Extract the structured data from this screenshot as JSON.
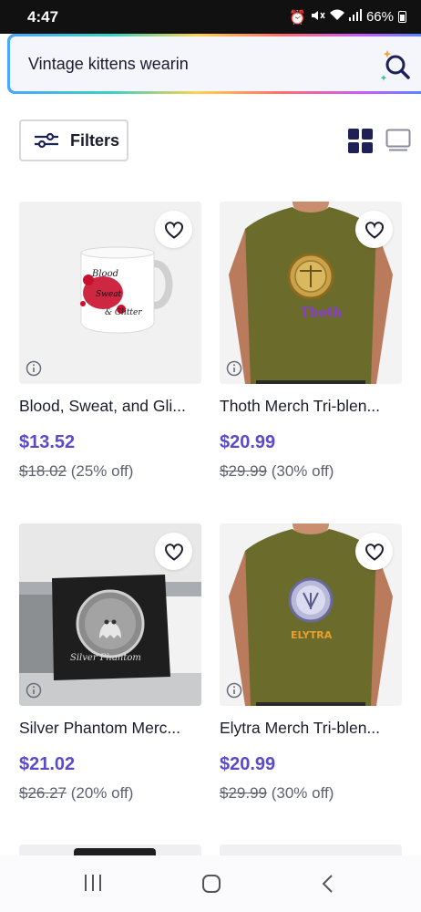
{
  "status_bar": {
    "time": "4:47",
    "battery": "66%"
  },
  "search": {
    "value": "Vintage kittens wearin"
  },
  "toolbar": {
    "filters_label": "Filters"
  },
  "products": [
    {
      "title": "Blood, Sweat, and Gli...",
      "price": "$13.52",
      "original_price": "$18.02",
      "discount": "(25% off)",
      "image_text": [
        "Blood",
        "Sweat",
        "& Glitter"
      ]
    },
    {
      "title": "Thoth Merch Tri-blen...",
      "price": "$20.99",
      "original_price": "$29.99",
      "discount": "(30% off)",
      "image_text": [
        "Thoth"
      ]
    },
    {
      "title": "Silver Phantom Merc...",
      "price": "$21.02",
      "original_price": "$26.27",
      "discount": "(20% off)",
      "image_text": [
        "Silver Phantom"
      ]
    },
    {
      "title": "Elytra Merch Tri-blen...",
      "price": "$20.99",
      "original_price": "$29.99",
      "discount": "(30% off)",
      "image_text": [
        "ELYTRA"
      ]
    }
  ],
  "colors": {
    "price": "#5a4bc8",
    "navy": "#1d2156",
    "shirt": "#6b6b2c"
  }
}
